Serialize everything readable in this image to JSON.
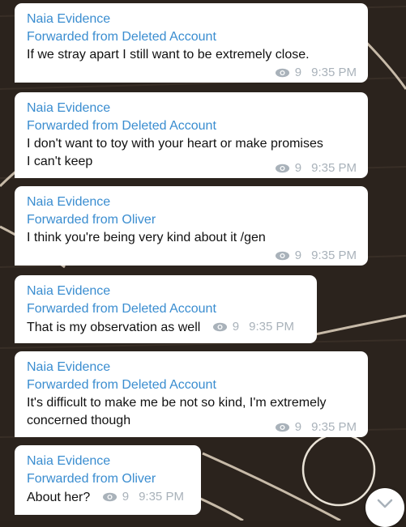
{
  "messages": [
    {
      "channel": "Naia Evidence",
      "forwarded": "Forwarded from Deleted Account",
      "text": "If we stray apart I still want to be extremely close.",
      "views": "9",
      "time": "9:35 PM"
    },
    {
      "channel": "Naia Evidence",
      "forwarded": "Forwarded from Deleted Account",
      "text_lines": [
        "I don't want to toy with your heart or make promises",
        "I can't keep"
      ],
      "views": "9",
      "time": "9:35 PM"
    },
    {
      "channel": "Naia Evidence",
      "forwarded": "Forwarded from Oliver",
      "text": "I think you're being very kind about it /gen",
      "views": "9",
      "time": "9:35 PM"
    },
    {
      "channel": "Naia Evidence",
      "forwarded": "Forwarded from Deleted Account",
      "text": "That is my observation as well",
      "views": "9",
      "time": "9:35 PM"
    },
    {
      "channel": "Naia Evidence",
      "forwarded": "Forwarded from Deleted Account",
      "text_lines": [
        "It's difficult to make me be not so kind, I'm extremely",
        "concerned though"
      ],
      "views": "9",
      "time": "9:35 PM"
    },
    {
      "channel": "Naia Evidence",
      "forwarded": "Forwarded from Oliver",
      "text": "About her?",
      "views": "9",
      "time": "9:35 PM"
    }
  ],
  "icons": {
    "views": "eye-icon",
    "scroll": "chevron-down-icon"
  },
  "colors": {
    "link": "#3a8dd0",
    "meta": "#a9b2ba",
    "bubble": "#ffffff"
  }
}
